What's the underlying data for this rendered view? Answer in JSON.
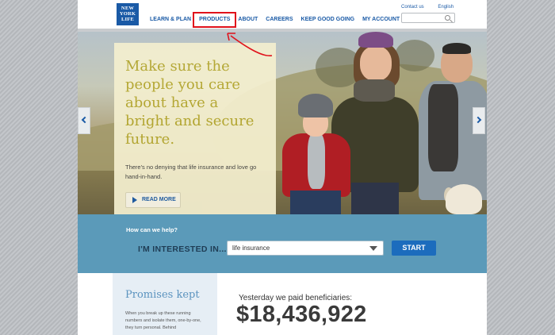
{
  "logo": {
    "lines": [
      "NEW",
      "YORK",
      "LIFE"
    ]
  },
  "nav": {
    "items": [
      {
        "label": "LEARN & PLAN"
      },
      {
        "label": "PRODUCTS"
      },
      {
        "label": "ABOUT"
      },
      {
        "label": "CAREERS"
      },
      {
        "label": "KEEP GOOD GOING"
      },
      {
        "label": "MY ACCOUNT"
      }
    ]
  },
  "utility": {
    "contact": "Contact us",
    "language": "English"
  },
  "search": {
    "placeholder": ""
  },
  "hero": {
    "headline": "Make sure the people you care about have a bright and secure future.",
    "subtext": "There's no denying that life insurance and love go hand-in-hand.",
    "read_more": "READ MORE"
  },
  "help": {
    "question": "How can we help?",
    "label": "I'M INTERESTED IN...",
    "selected": "life insurance",
    "start": "START"
  },
  "promises": {
    "title": "Promises kept",
    "text": "When you break up these running numbers and isolate them, one-by-one, they turn personal. Behind"
  },
  "paid": {
    "label": "Yesterday we paid beneficiaries:",
    "amount": "$18,436,922"
  },
  "colors": {
    "brand_blue": "#1a5aa6",
    "help_band": "#5b9ab9",
    "highlight_red": "#e0121b",
    "headline_gold": "#b4a62c"
  }
}
